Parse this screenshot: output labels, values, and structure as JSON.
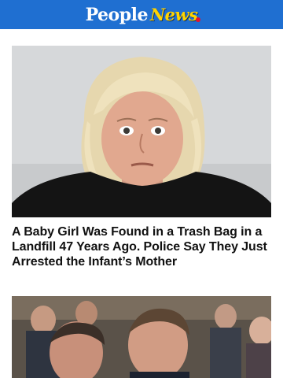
{
  "header": {
    "logo_people": "People",
    "logo_news": "News",
    "background": "#1f6fd1",
    "news_color": "#ffd400"
  },
  "articles": [
    {
      "headline": "A Baby Girl Was Found in a Trash Bag in a Landfill 47 Years Ago. Police Say They Just Arrested the Infant’s Mother",
      "image": "mugshot-photo"
    },
    {
      "headline": "",
      "image": "courtroom-photo"
    }
  ]
}
